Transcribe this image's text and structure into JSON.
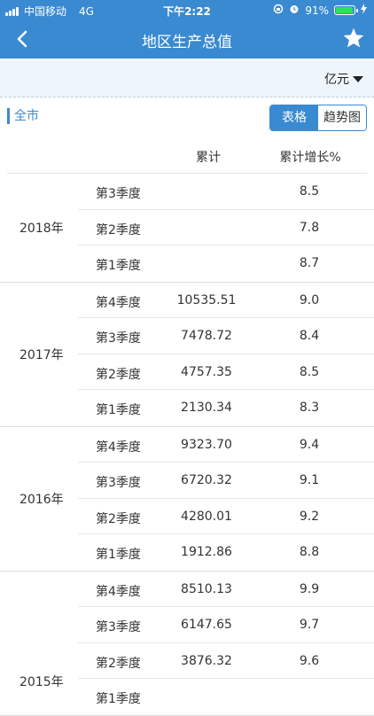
{
  "status": {
    "carrier": "中国移动",
    "network": "4G",
    "time": "下午2:22",
    "battery": "91%"
  },
  "nav": {
    "title": "地区生产总值"
  },
  "unit": {
    "label": "亿元"
  },
  "region": "全市",
  "toggle": {
    "table": "表格",
    "trend": "趋势图"
  },
  "table": {
    "headers": {
      "cumulative": "累计",
      "growth": "累计增长%"
    },
    "years": [
      {
        "year": "2018年",
        "quarters": [
          {
            "q": "第3季度",
            "cum": "",
            "growth": "8.5"
          },
          {
            "q": "第2季度",
            "cum": "",
            "growth": "7.8"
          },
          {
            "q": "第1季度",
            "cum": "",
            "growth": "8.7"
          }
        ]
      },
      {
        "year": "2017年",
        "quarters": [
          {
            "q": "第4季度",
            "cum": "10535.51",
            "growth": "9.0"
          },
          {
            "q": "第3季度",
            "cum": "7478.72",
            "growth": "8.4"
          },
          {
            "q": "第2季度",
            "cum": "4757.35",
            "growth": "8.5"
          },
          {
            "q": "第1季度",
            "cum": "2130.34",
            "growth": "8.3"
          }
        ]
      },
      {
        "year": "2016年",
        "quarters": [
          {
            "q": "第4季度",
            "cum": "9323.70",
            "growth": "9.4"
          },
          {
            "q": "第3季度",
            "cum": "6720.32",
            "growth": "9.1"
          },
          {
            "q": "第2季度",
            "cum": "4280.01",
            "growth": "9.2"
          },
          {
            "q": "第1季度",
            "cum": "1912.86",
            "growth": "8.8"
          }
        ]
      },
      {
        "year": "2015年",
        "quarters": [
          {
            "q": "第4季度",
            "cum": "8510.13",
            "growth": "9.9"
          },
          {
            "q": "第3季度",
            "cum": "6147.65",
            "growth": "9.7"
          },
          {
            "q": "第2季度",
            "cum": "3876.32",
            "growth": "9.6"
          },
          {
            "q": "第1季度",
            "cum": "",
            "growth": ""
          }
        ]
      }
    ]
  }
}
